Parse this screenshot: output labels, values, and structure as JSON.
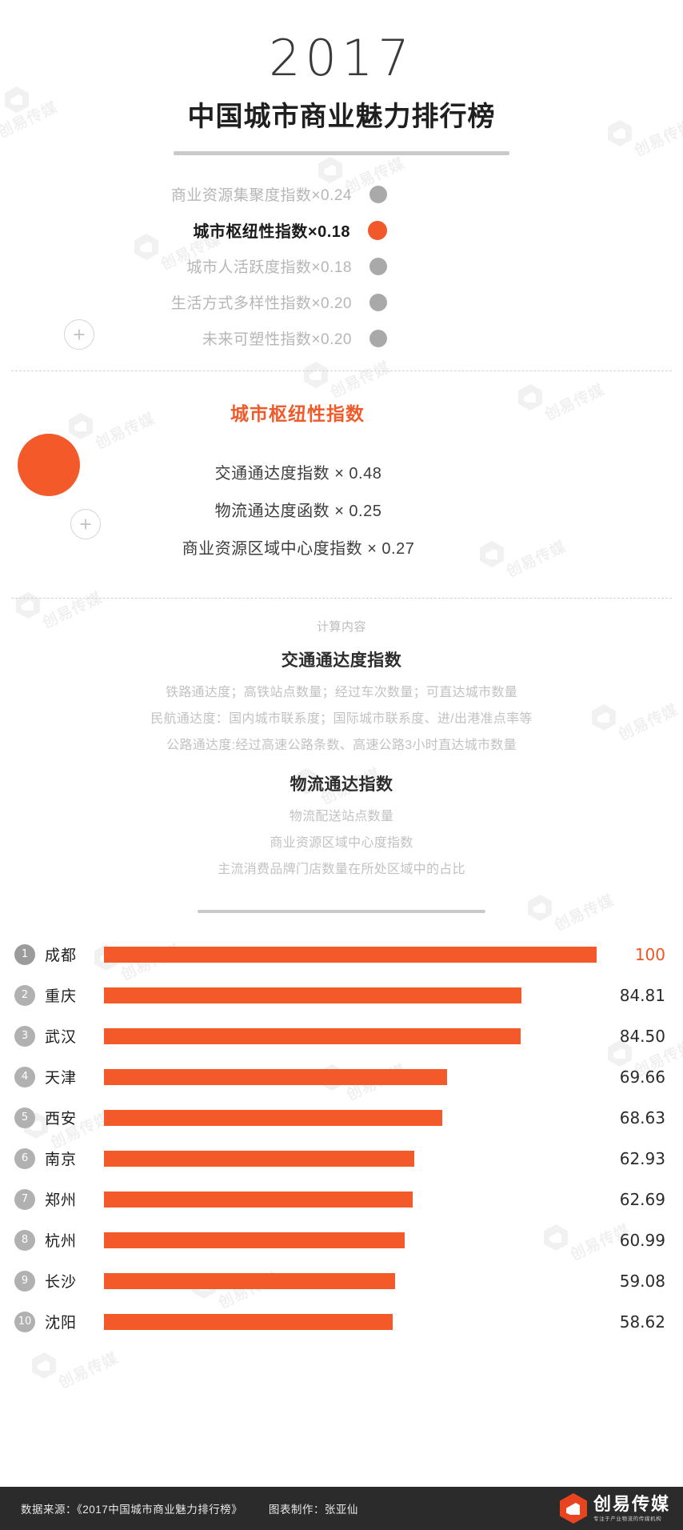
{
  "header": {
    "year": "2017",
    "title": "中国城市商业魅力排行榜"
  },
  "index_block": {
    "plus_icon": "plus-icon",
    "items": [
      {
        "label": "商业资源集聚度指数×0.24",
        "weight": 0.24,
        "active": false,
        "dot_color": "#a9a9a9"
      },
      {
        "label": "城市枢纽性指数×0.18",
        "weight": 0.18,
        "active": true,
        "dot_color": "#f1592a"
      },
      {
        "label": "城市人活跃度指数×0.18",
        "weight": 0.18,
        "active": false,
        "dot_color": "#a9a9a9"
      },
      {
        "label": "生活方式多样性指数×0.20",
        "weight": 0.2,
        "active": false,
        "dot_color": "#a9a9a9"
      },
      {
        "label": "未来可塑性指数×0.20",
        "weight": 0.2,
        "active": false,
        "dot_color": "#a9a9a9"
      }
    ]
  },
  "section_breakdown": {
    "title": "城市枢纽性指数",
    "title_color": "#ef5b2b",
    "circle_color": "#f4592a",
    "plus_icon": "plus-icon",
    "items": [
      {
        "label": "交通通达度指数 × 0.48",
        "weight": 0.48
      },
      {
        "label": "物流通达度函数 × 0.25",
        "weight": 0.25
      },
      {
        "label": "商业资源区域中心度指数 × 0.27",
        "weight": 0.27
      }
    ]
  },
  "section_calc": {
    "caption": "计算内容",
    "groups": [
      {
        "heading": "交通通达度指数",
        "lines": [
          "铁路通达度；高铁站点数量；经过车次数量；可直达城市数量",
          "民航通达度：国内城市联系度；国际城市联系度、进/出港准点率等",
          "公路通达度:经过高速公路条数、高速公路3小时直达城市数量"
        ]
      },
      {
        "heading": "物流通达指数",
        "lines": [
          "物流配送站点数量",
          "商业资源区域中心度指数",
          "主流消费品牌门店数量在所处区域中的占比"
        ]
      }
    ]
  },
  "chart_data": {
    "type": "bar",
    "title": "城市枢纽性指数",
    "xlabel": "",
    "ylabel": "",
    "orientation": "horizontal",
    "grid": false,
    "legend": "none",
    "xlim": [
      0,
      100
    ],
    "bar_color": "#f4592a",
    "categories": [
      "成都",
      "重庆",
      "武汉",
      "天津",
      "西安",
      "南京",
      "郑州",
      "杭州",
      "长沙",
      "沈阳"
    ],
    "ranks": [
      "1",
      "2",
      "3",
      "4",
      "5",
      "6",
      "7",
      "8",
      "9",
      "10"
    ],
    "values": [
      100,
      84.81,
      84.5,
      69.66,
      68.63,
      62.93,
      62.69,
      60.99,
      59.08,
      58.62
    ],
    "value_labels": [
      "100",
      "84.81",
      "84.50",
      "69.66",
      "68.63",
      "62.93",
      "62.69",
      "60.99",
      "59.08",
      "58.62"
    ]
  },
  "footer": {
    "source": "数据来源：《2017中国城市商业魅力排行榜》",
    "credit": "图表制作：张亚仙",
    "brand_name": "创易传媒",
    "brand_sub": "专注于产业物流的传媒机构",
    "brand_icon": "hexagon-logo-icon"
  },
  "watermark": {
    "text": "创易传媒",
    "sub": "专注于产业物流的传媒机构"
  }
}
